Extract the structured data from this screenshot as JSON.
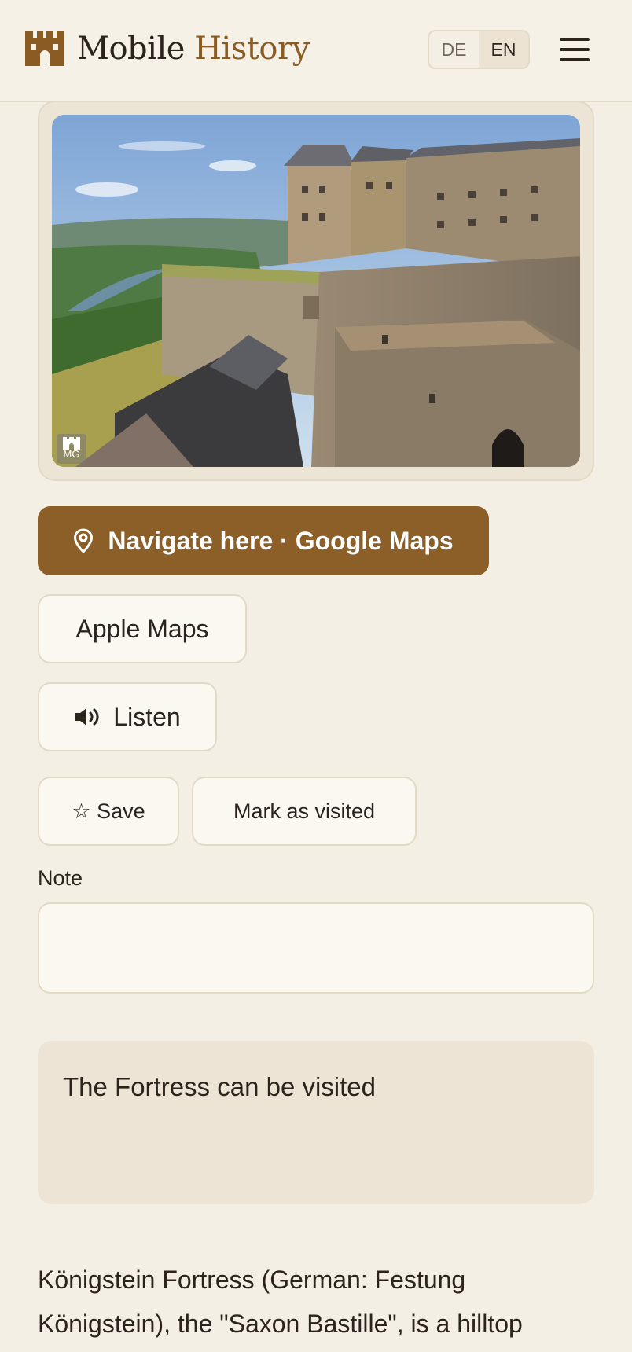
{
  "header": {
    "logo_word1": "Mobile",
    "logo_word2": "History",
    "languages": [
      "DE",
      "EN"
    ],
    "active_language": "EN",
    "menu_icon": "hamburger-menu-icon"
  },
  "photo": {
    "badge_text": "MG",
    "badge_icon": "castle-icon"
  },
  "actions": {
    "navigate_label": "Navigate here · Google Maps",
    "navigate_icon": "map-pin-icon",
    "apple_maps_label": "Apple Maps",
    "listen_label": "Listen",
    "listen_icon": "speaker-icon",
    "save_label": "☆ Save",
    "visited_label": "Mark as visited"
  },
  "note": {
    "label": "Note",
    "value": "",
    "placeholder": ""
  },
  "info": {
    "text": "The Fortress can be visited"
  },
  "description": {
    "text": "Königstein Fortress (German: Festung Königstein), the \"Saxon Bastille\", is a hilltop"
  },
  "colors": {
    "accent": "#8c5e28",
    "background": "#f4efe5",
    "info_box": "#ede4d6"
  }
}
